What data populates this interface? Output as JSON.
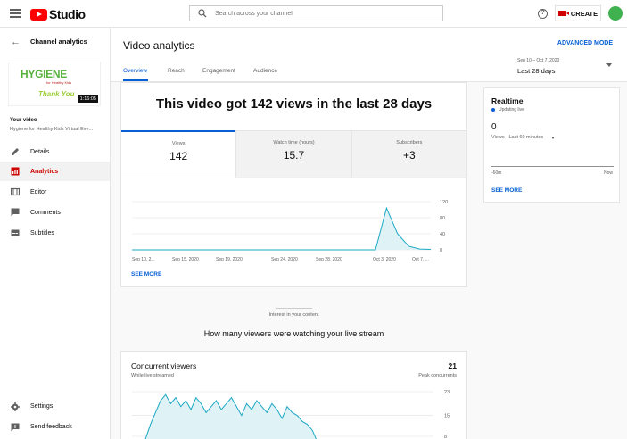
{
  "topbar": {
    "logo_text": "Studio",
    "search_placeholder": "Search across your channel",
    "create_label": "CREATE"
  },
  "sidebar": {
    "title": "Channel analytics",
    "thumbnail": {
      "brand_text": "HYGIENE",
      "brand_sub": "for Healthy Kids",
      "thank_you": "Thank You",
      "duration": "1:16:05"
    },
    "your_video_label": "Your video",
    "video_title": "Hygiene for Healthy Kids Virtual Eve...",
    "nav": [
      {
        "label": "Details",
        "icon": "pencil-icon",
        "active": false
      },
      {
        "label": "Analytics",
        "icon": "analytics-icon",
        "active": true
      },
      {
        "label": "Editor",
        "icon": "film-icon",
        "active": false
      },
      {
        "label": "Comments",
        "icon": "comment-icon",
        "active": false
      },
      {
        "label": "Subtitles",
        "icon": "subtitles-icon",
        "active": false
      }
    ],
    "bottom_nav": [
      {
        "label": "Settings",
        "icon": "gear-icon"
      },
      {
        "label": "Send feedback",
        "icon": "feedback-icon"
      }
    ]
  },
  "header": {
    "title": "Video analytics",
    "advanced_mode": "ADVANCED MODE",
    "tabs": [
      "Overview",
      "Reach",
      "Engagement",
      "Audience"
    ],
    "active_tab": "Overview",
    "date_range": "Sep 10 – Oct 7, 2020",
    "date_label": "Last 28 days"
  },
  "overview": {
    "headline": "This video got 142 views in the last 28 days",
    "metrics": [
      {
        "label": "Views",
        "value": "142"
      },
      {
        "label": "Watch time (hours)",
        "value": "15.7"
      },
      {
        "label": "Subscribers",
        "value": "+3"
      }
    ],
    "see_more": "SEE MORE"
  },
  "chart_data": [
    {
      "type": "area",
      "title": "",
      "xlabel": "",
      "ylabel": "",
      "x_tick_labels": [
        "Sep 10, 2...",
        "Sep 15, 2020",
        "Sep 19, 2020",
        "Sep 24, 2020",
        "Sep 28, 2020",
        "Oct 3, 2020",
        "Oct 7, ..."
      ],
      "y_ticks": [
        "0",
        "40",
        "80",
        "120"
      ],
      "ylim": [
        0,
        120
      ],
      "series": [
        {
          "values": [
            0,
            0,
            0,
            0,
            0,
            0,
            0,
            0,
            0,
            0,
            0,
            0,
            0,
            0,
            0,
            0,
            0,
            0,
            0,
            0,
            0,
            0,
            0,
            104,
            40,
            9,
            2,
            1
          ]
        }
      ],
      "grid": true
    },
    {
      "type": "line",
      "title": "Concurrent viewers",
      "xlabel": "",
      "ylabel": "",
      "y_ticks": [
        "8",
        "15",
        "23"
      ],
      "ylim": [
        8,
        23
      ],
      "series": [
        {
          "values": [
            7,
            12,
            16,
            20,
            22,
            19,
            21,
            18,
            20,
            17,
            21,
            19,
            16,
            18,
            20,
            17,
            19,
            21,
            18,
            15,
            19,
            17,
            20,
            18,
            16,
            19,
            17,
            14,
            18,
            16,
            15,
            13,
            12,
            10,
            6,
            4,
            2,
            1
          ]
        }
      ],
      "grid": true
    }
  ],
  "realtime": {
    "title": "Realtime",
    "updating": "Updating live",
    "value": "0",
    "sub": "Views · Last 60 minutes",
    "axis_left": "-60m",
    "axis_right": "Now",
    "see_more": "SEE MORE"
  },
  "interest": "Interest in your content",
  "live_section": {
    "title": "How many viewers were watching your live stream",
    "card_title": "Concurrent viewers",
    "card_sub": "While live streamed",
    "peak_value": "21",
    "peak_label": "Peak concurrents"
  },
  "colors": {
    "accent": "#065fd4",
    "brand_red": "#ff0000",
    "active_nav": "#cc0000",
    "chart_line": "#1aa8c4",
    "chart_fill": "#dff2f6"
  }
}
